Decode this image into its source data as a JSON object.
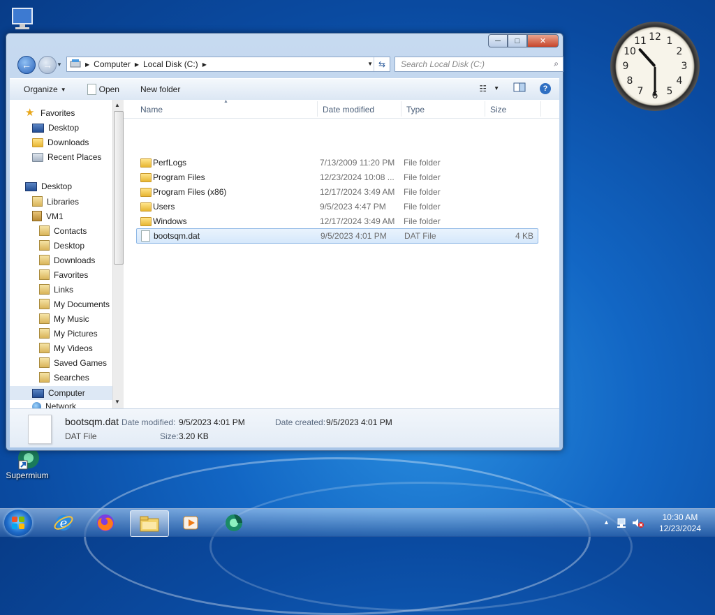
{
  "desktop": {
    "icons": [
      {
        "label": "Supermium"
      }
    ]
  },
  "window": {
    "caption_buttons": {
      "minimize": "─",
      "maximize": "□",
      "close": "✕"
    },
    "address": {
      "crumbs": [
        "Computer",
        "Local Disk (C:)"
      ]
    },
    "search": {
      "placeholder": "Search Local Disk (C:)"
    },
    "toolbar": {
      "organize": "Organize",
      "open": "Open",
      "new_folder": "New folder"
    },
    "nav": {
      "favorites": "Favorites",
      "fav_items": [
        "Desktop",
        "Downloads",
        "Recent Places"
      ],
      "desktop": "Desktop",
      "libraries": "Libraries",
      "user": "VM1",
      "user_items": [
        "Contacts",
        "Desktop",
        "Downloads",
        "Favorites",
        "Links",
        "My Documents",
        "My Music",
        "My Pictures",
        "My Videos",
        "Saved Games",
        "Searches"
      ],
      "computer": "Computer",
      "network": "Network"
    },
    "columns": {
      "name": "Name",
      "date": "Date modified",
      "type": "Type",
      "size": "Size"
    },
    "files": [
      {
        "name": "PerfLogs",
        "date": "7/13/2009 11:20 PM",
        "type": "File folder",
        "size": ""
      },
      {
        "name": "Program Files",
        "date": "12/23/2024 10:08 ...",
        "type": "File folder",
        "size": ""
      },
      {
        "name": "Program Files (x86)",
        "date": "12/17/2024 3:49 AM",
        "type": "File folder",
        "size": ""
      },
      {
        "name": "Users",
        "date": "9/5/2023 4:47 PM",
        "type": "File folder",
        "size": ""
      },
      {
        "name": "Windows",
        "date": "12/17/2024 3:49 AM",
        "type": "File folder",
        "size": ""
      },
      {
        "name": "bootsqm.dat",
        "date": "9/5/2023 4:01 PM",
        "type": "DAT File",
        "size": "4 KB"
      }
    ],
    "details": {
      "name": "bootsqm.dat",
      "type": "DAT File",
      "modified_label": "Date modified:",
      "modified": "9/5/2023 4:01 PM",
      "size_label": "Size:",
      "size": "3.20 KB",
      "created_label": "Date created:",
      "created": "9/5/2023 4:01 PM"
    }
  },
  "gadget_clock": {
    "numerals": [
      "12",
      "1",
      "2",
      "3",
      "4",
      "5",
      "6",
      "7",
      "8",
      "9",
      "10",
      "11"
    ]
  },
  "taskbar": {
    "time": "10:30 AM",
    "date": "12/23/2024"
  },
  "colors": {
    "accent": "#1266c4",
    "selection": "#d6e8fb"
  }
}
